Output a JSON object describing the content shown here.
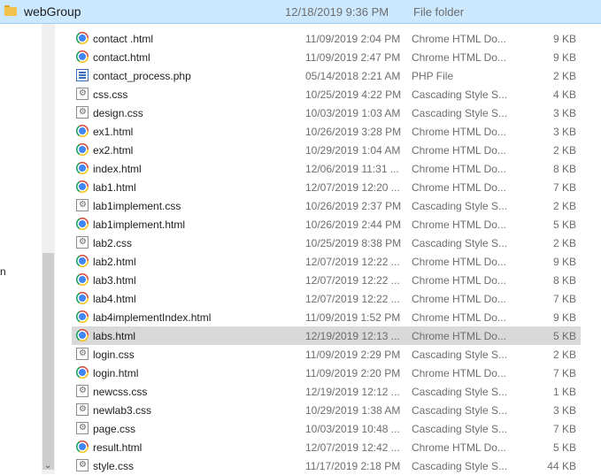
{
  "header": {
    "name": "webGroup",
    "date": "12/18/2019 9:36 PM",
    "type": "File folder",
    "icon": "folder-icon"
  },
  "left_pane": {
    "fragment": "n"
  },
  "left_scrollbar": {
    "arrow_down": "⌄"
  },
  "files": [
    {
      "name": "contact .html",
      "date": "11/09/2019 2:04 PM",
      "type": "Chrome HTML Do...",
      "size": "9 KB",
      "icon": "chrome"
    },
    {
      "name": "contact.html",
      "date": "11/09/2019 2:47 PM",
      "type": "Chrome HTML Do...",
      "size": "9 KB",
      "icon": "chrome"
    },
    {
      "name": "contact_process.php",
      "date": "05/14/2018 2:21 AM",
      "type": "PHP File",
      "size": "2 KB",
      "icon": "php"
    },
    {
      "name": "css.css",
      "date": "10/25/2019 4:22 PM",
      "type": "Cascading Style S...",
      "size": "4 KB",
      "icon": "css"
    },
    {
      "name": "design.css",
      "date": "10/03/2019 1:03 AM",
      "type": "Cascading Style S...",
      "size": "3 KB",
      "icon": "css"
    },
    {
      "name": "ex1.html",
      "date": "10/26/2019 3:28 PM",
      "type": "Chrome HTML Do...",
      "size": "3 KB",
      "icon": "chrome"
    },
    {
      "name": "ex2.html",
      "date": "10/29/2019 1:04 AM",
      "type": "Chrome HTML Do...",
      "size": "2 KB",
      "icon": "chrome"
    },
    {
      "name": "index.html",
      "date": "12/06/2019 11:31 ...",
      "type": "Chrome HTML Do...",
      "size": "8 KB",
      "icon": "chrome"
    },
    {
      "name": "lab1.html",
      "date": "12/07/2019 12:20 ...",
      "type": "Chrome HTML Do...",
      "size": "7 KB",
      "icon": "chrome"
    },
    {
      "name": "lab1implement.css",
      "date": "10/26/2019 2:37 PM",
      "type": "Cascading Style S...",
      "size": "2 KB",
      "icon": "css"
    },
    {
      "name": "lab1implement.html",
      "date": "10/26/2019 2:44 PM",
      "type": "Chrome HTML Do...",
      "size": "5 KB",
      "icon": "chrome"
    },
    {
      "name": "lab2.css",
      "date": "10/25/2019 8:38 PM",
      "type": "Cascading Style S...",
      "size": "2 KB",
      "icon": "css"
    },
    {
      "name": "lab2.html",
      "date": "12/07/2019 12:22 ...",
      "type": "Chrome HTML Do...",
      "size": "9 KB",
      "icon": "chrome"
    },
    {
      "name": "lab3.html",
      "date": "12/07/2019 12:22 ...",
      "type": "Chrome HTML Do...",
      "size": "8 KB",
      "icon": "chrome"
    },
    {
      "name": "lab4.html",
      "date": "12/07/2019 12:22 ...",
      "type": "Chrome HTML Do...",
      "size": "7 KB",
      "icon": "chrome"
    },
    {
      "name": "lab4implementIndex.html",
      "date": "11/09/2019 1:52 PM",
      "type": "Chrome HTML Do...",
      "size": "9 KB",
      "icon": "chrome"
    },
    {
      "name": "labs.html",
      "date": "12/19/2019 12:13 ...",
      "type": "Chrome HTML Do...",
      "size": "5 KB",
      "icon": "chrome",
      "selected": true
    },
    {
      "name": "login.css",
      "date": "11/09/2019 2:29 PM",
      "type": "Cascading Style S...",
      "size": "2 KB",
      "icon": "css"
    },
    {
      "name": "login.html",
      "date": "11/09/2019 2:20 PM",
      "type": "Chrome HTML Do...",
      "size": "7 KB",
      "icon": "chrome"
    },
    {
      "name": "newcss.css",
      "date": "12/19/2019 12:12 ...",
      "type": "Cascading Style S...",
      "size": "1 KB",
      "icon": "css"
    },
    {
      "name": "newlab3.css",
      "date": "10/29/2019 1:38 AM",
      "type": "Cascading Style S...",
      "size": "3 KB",
      "icon": "css"
    },
    {
      "name": "page.css",
      "date": "10/03/2019 10:48 ...",
      "type": "Cascading Style S...",
      "size": "7 KB",
      "icon": "css"
    },
    {
      "name": "result.html",
      "date": "12/07/2019 12:42 ...",
      "type": "Chrome HTML Do...",
      "size": "5 KB",
      "icon": "chrome"
    },
    {
      "name": "style.css",
      "date": "11/17/2019 2:18 PM",
      "type": "Cascading Style S...",
      "size": "44 KB",
      "icon": "css"
    }
  ]
}
